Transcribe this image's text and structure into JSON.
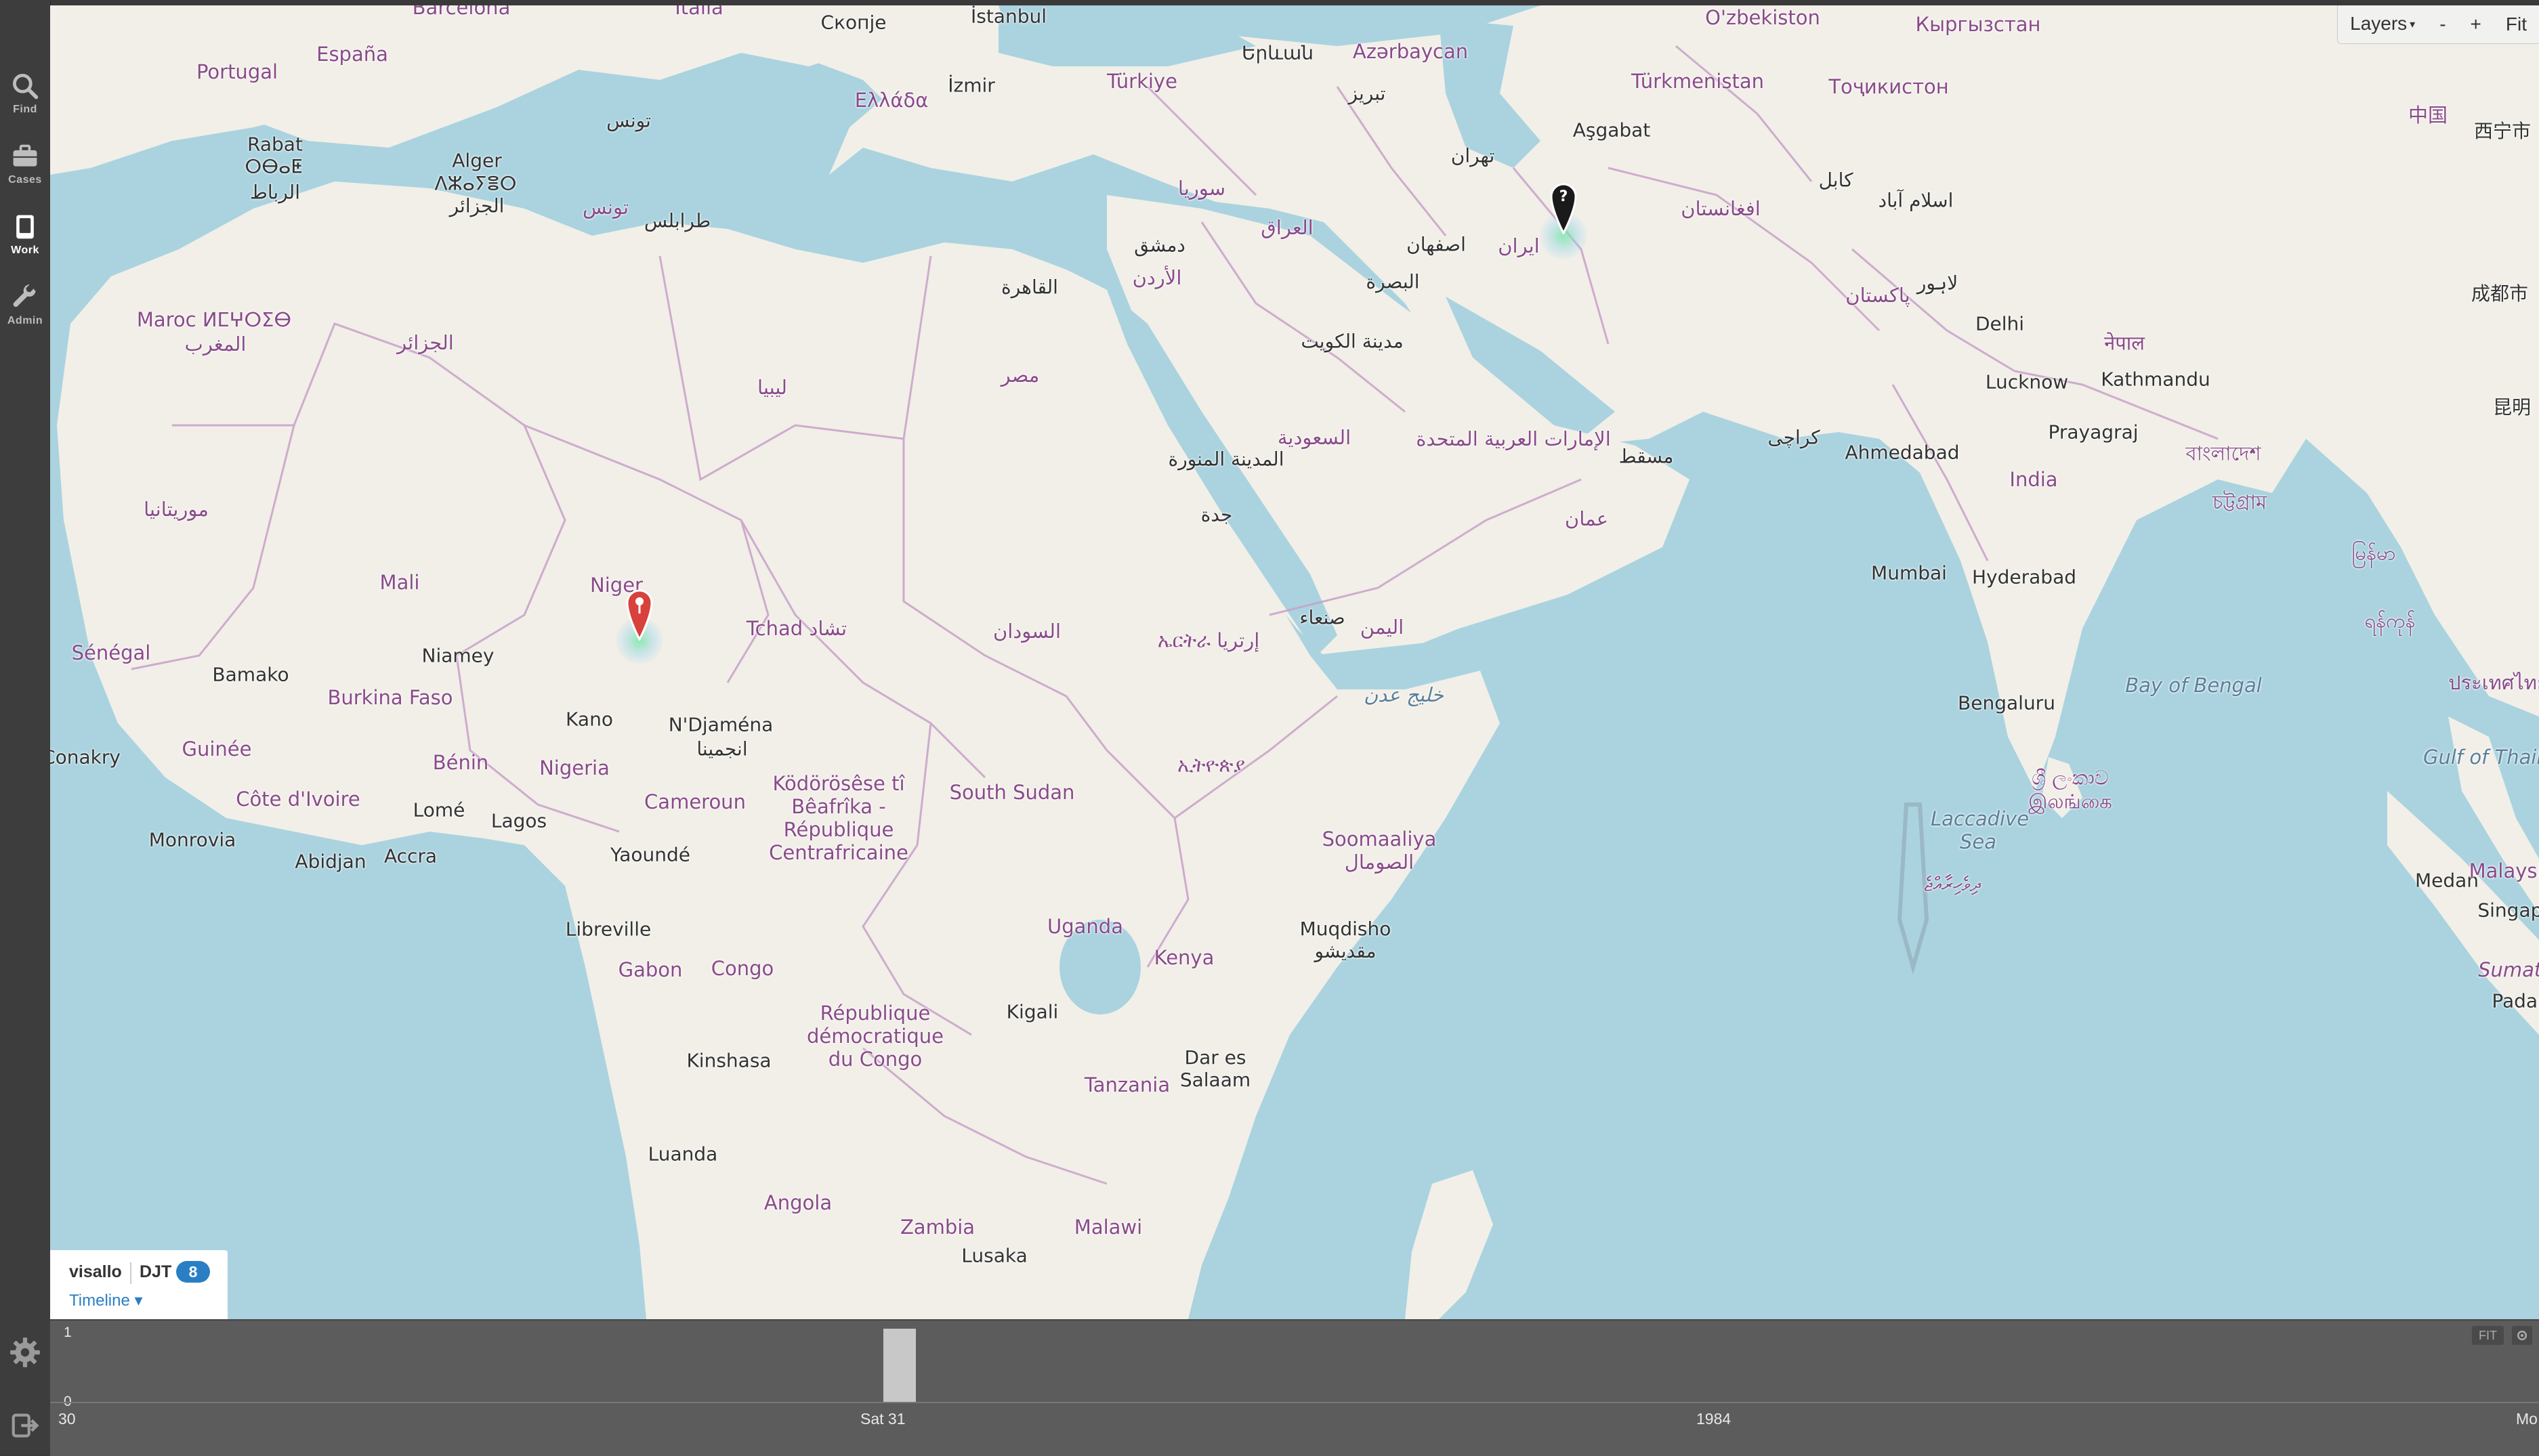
{
  "rail": {
    "items": [
      {
        "label": "Find",
        "icon": "search-icon"
      },
      {
        "label": "Cases",
        "icon": "briefcase-icon"
      },
      {
        "label": "Work",
        "icon": "book-icon",
        "active": true
      },
      {
        "label": "Admin",
        "icon": "wrench-icon"
      }
    ],
    "settings_icon": "gear-icon",
    "logout_icon": "logout-icon"
  },
  "map_controls": {
    "layers": "Layers",
    "zoom_out": "-",
    "zoom_in": "+",
    "fit": "Fit"
  },
  "map": {
    "labels": {
      "barcelona": "Barcelona",
      "italia": "Italia",
      "skopje": "Скопје",
      "istanbul": "İstanbul",
      "uzbekistan": "O'zbekiston",
      "kyrgyzstan": "Кыргызстан",
      "portugal": "Portugal",
      "espana": "España",
      "izmir": "İzmir",
      "turkiye": "Türkiye",
      "yerevan": "Երևան",
      "azarbaycan": "Azərbaycan",
      "turkmenistan": "Türkmenistan",
      "tajikistan": "Тоҷикистон",
      "china_zh": "中国",
      "xining": "西宁市",
      "ellada": "Ελλάδα",
      "tabriz": "تبریز",
      "ashgabat": "Aşgabat",
      "rabat": "Rabat",
      "rabat_tf": "ⵔⴱⴰⵟ",
      "rabat_ar": "الرباط",
      "alger": "Alger",
      "alger_tf": "ⴷⵣⴰⵢⴻⵔ",
      "alger_ar": "الجزائر",
      "tunis_ar": "تونس",
      "tunisia_ar": "تونس",
      "tehran": "تهران",
      "kabul": "کابل",
      "islamabad": "اسلام آباد",
      "afghanistan": "افغانستان",
      "tarabulus": "طرابلس",
      "syria": "سوريا",
      "iraq": "العراق",
      "dimashq": "دمشق",
      "isfahan": "اصفهان",
      "iran": "ایران",
      "pakistan": "پاکستان",
      "lahore": "لاہور",
      "chengdu": "成都市",
      "maroc": "Maroc ⵍⵎⵖⵔⵉⴱ",
      "maghrib": "المغرب",
      "jazair": "الجزائر",
      "qahira": "القاهرة",
      "urdun": "الأردن",
      "basra": "البصرة",
      "kuwait": "مدينة الكويت",
      "delhi": "Delhi",
      "nepal": "नेपाल",
      "kunming": "昆明",
      "misr": "مصر",
      "libya": "ليبيا",
      "lucknow": "Lucknow",
      "kathmandu": "Kathmandu",
      "saudi": "السعودية",
      "madina": "المدينة المنورة",
      "uae": "الإمارات العربية المتحدة",
      "karachi": "کراچی",
      "ahmedabad": "Ahmedabad",
      "prayagraj": "Prayagraj",
      "muscat": "مسقط",
      "india": "India",
      "bangladesh": "বাংলাদেশ",
      "jeddah": "جدة",
      "oman": "عمان",
      "mauritania": "موريتانيا",
      "chattogram": "চট্টগ্রাম",
      "myanmar": "မြန်မာ",
      "mali": "Mali",
      "niger": "Niger",
      "mumbai": "Mumbai",
      "hyderabad": "Hyderabad",
      "tchad": "Tchad تشاد",
      "sudan": "السودان",
      "eritrea": "ኤርትራ إرتريا",
      "sanaa": "صنعاء",
      "yemen": "اليمن",
      "yangon": "ရန်ကုန်",
      "senegal": "Sénégal",
      "niamey": "Niamey",
      "bamako": "Bamako",
      "bay_bengal": "Bay of Bengal",
      "thailand": "ประเทศไทย",
      "burkina": "Burkina Faso",
      "kano": "Kano",
      "gulf_aden": "خليج عدن",
      "bengaluru": "Bengaluru",
      "ndjamena": "N'Djaména",
      "ndjamena_ar": "انجمينا",
      "gulf_thailand": "Gulf of Thailand",
      "conakry": "Conakry",
      "benin": "Bénin",
      "nigeria": "Nigeria",
      "ethiopia": "ኢትዮጵያ",
      "guinee": "Guinée",
      "cote_ivoire": "Côte d'Ivoire",
      "lome": "Lomé",
      "cameroun": "Cameroun",
      "south_sudan": "South Sudan",
      "car": "Ködörösêse tî Bêafrîka - République Centrafricaine",
      "lanka": "ශ්‍රී ලංකාව இலங்கை",
      "monrovia": "Monrovia",
      "lagos": "Lagos",
      "laccadive": "Laccadive Sea",
      "medan": "Medan",
      "malaysia": "Malaysia",
      "abidjan": "Abidjan",
      "accra": "Accra",
      "yaounde": "Yaoundé",
      "somalia": "Soomaaliya الصومال",
      "maldives": "ދިވެހިރާއްޖެ",
      "singapore": "Singapore",
      "uganda": "Uganda",
      "libreville": "Libreville",
      "mogadishu": "Muqdisho مقديشو",
      "sumatra": "Sumatra",
      "gabon": "Gabon",
      "congo": "Congo",
      "kenya": "Kenya",
      "padang": "Padang",
      "kigali": "Kigali",
      "rdc": "République démocratique du Congo",
      "dar": "Dar es Salaam",
      "kinshasa": "Kinshasa",
      "tanzania": "Tanzania",
      "luanda": "Luanda",
      "angola": "Angola",
      "zambia": "Zambia",
      "malawi": "Malawi",
      "lusaka": "Lusaka"
    },
    "markers": [
      {
        "name": "marker-niger",
        "color": "#d9413c",
        "glyph": ""
      },
      {
        "name": "marker-iran",
        "color": "#1a1a1a",
        "glyph": "?"
      }
    ]
  },
  "product": {
    "name": "visallo",
    "tag": "DJT",
    "count": "8",
    "timeline_label": "Timeline"
  },
  "timeline": {
    "y_max": "1",
    "y_min": "0",
    "x_labels": [
      "30",
      "Sat 31",
      "1984",
      "Mo"
    ],
    "fit": "FIT"
  },
  "colors": {
    "sea": "#aad3df",
    "land": "#f1efe8",
    "border": "#c8a0c8",
    "rail": "#3d3d3d",
    "timeline": "#5c5c5c",
    "accent": "#2a7fc4"
  }
}
